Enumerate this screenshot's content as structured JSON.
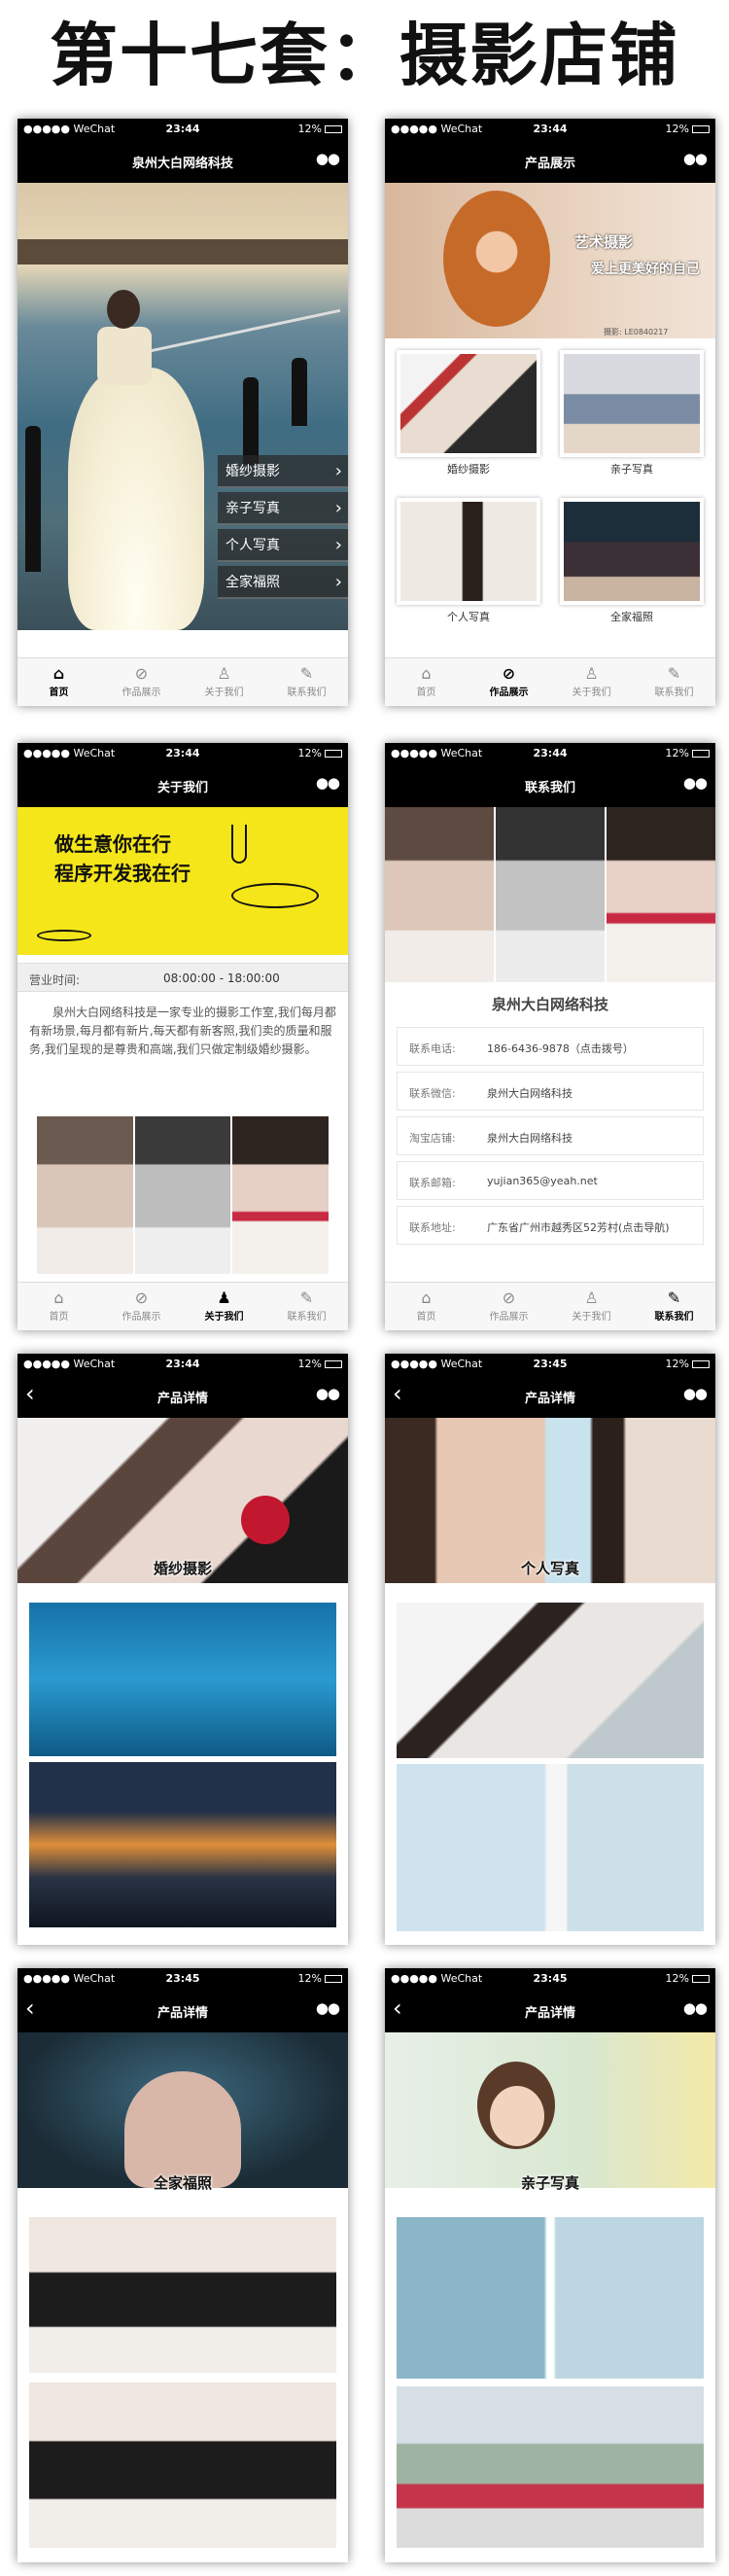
{
  "page_title": "第十七套：摄影店铺",
  "status_bar": {
    "carrier": "●●●●● WeChat",
    "time_a": "23:44",
    "time_b": "23:45",
    "battery": "12%"
  },
  "menu_dots": "●●",
  "back": "‹",
  "tabs": {
    "home": "首页",
    "works": "作品展示",
    "about": "关于我们",
    "contact": "联系我们"
  },
  "s1": {
    "title": "泉州大白网络科技",
    "menu": [
      "婚纱摄影",
      "亲子写真",
      "个人写真",
      "全家福照"
    ]
  },
  "s2": {
    "title": "产品展示",
    "banner_text1": "艺术摄影",
    "banner_text2": "爱上更美好的自己",
    "banner_credit": "摄影: LE0840217",
    "items": [
      "婚纱摄影",
      "亲子写真",
      "个人写真",
      "全家福照"
    ]
  },
  "s3": {
    "title": "关于我们",
    "banner_l1": "做生意你在行",
    "banner_l2": "程序开发我在行",
    "hours_label": "营业时间:",
    "hours_value": "08:00:00 - 18:00:00",
    "intro": "泉州大白网络科技是一家专业的摄影工作室,我们每月都有新场景,每月都有新片,每天都有新客照,我们卖的质量和服务,我们呈现的是尊贵和高端,我们只做定制级婚纱摄影。"
  },
  "s4": {
    "title": "联系我们",
    "company": "泉州大白网络科技",
    "rows": [
      {
        "label": "联系电话:",
        "value": "186-6436-9878（点击拨号）"
      },
      {
        "label": "联系微信:",
        "value": "泉州大白网络科技"
      },
      {
        "label": "淘宝店铺:",
        "value": "泉州大白网络科技"
      },
      {
        "label": "联系邮箱:",
        "value": "yujian365@yeah.net"
      },
      {
        "label": "联系地址:",
        "value": "广东省广州市越秀区52芳村(点击导航)"
      }
    ]
  },
  "detail_title": "产品详情",
  "d1": {
    "label": "婚纱摄影"
  },
  "d2": {
    "label": "个人写真"
  },
  "d3": {
    "label": "全家福照"
  },
  "d4": {
    "label": "亲子写真"
  },
  "colors": {
    "bar": "#000000",
    "yellow": "#f5e61a",
    "menu_overlay": "#282828"
  }
}
